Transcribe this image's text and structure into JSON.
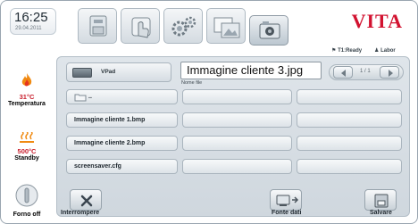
{
  "header": {
    "time": "16:25",
    "date": "29.04.2011",
    "brand": "VITA",
    "tabs": [
      {
        "icon": "furnace-program-icon"
      },
      {
        "icon": "touch-hand-icon"
      },
      {
        "icon": "gears-settings-icon"
      },
      {
        "icon": "photo-gallery-icon"
      },
      {
        "icon": "camera-icon"
      }
    ],
    "status": {
      "ready": "T1:Ready",
      "user": "Labor"
    }
  },
  "sidebar": {
    "temperature": {
      "value": "31°C",
      "label": "Temperatura"
    },
    "standby": {
      "value": "500°C",
      "label": "Standby"
    },
    "power": {
      "label": "Forno off"
    }
  },
  "panel": {
    "source": "VPad",
    "filename_value": "Immagine cliente 3.jpg",
    "filename_caption": "Nome file",
    "pager": "1 / 1",
    "files": [
      {
        "label": ".."
      },
      {
        "label": "Immagine cliente 1.bmp"
      },
      {
        "label": "Immagine cliente 2.bmp"
      },
      {
        "label": "screensaver.cfg"
      }
    ],
    "actions": {
      "cancel": "Interrompere",
      "source": "Fonte dati",
      "save": "Salvare"
    }
  },
  "colors": {
    "brand": "#d21230",
    "temperature": "#c81d2b",
    "flame": "#f08a12"
  }
}
